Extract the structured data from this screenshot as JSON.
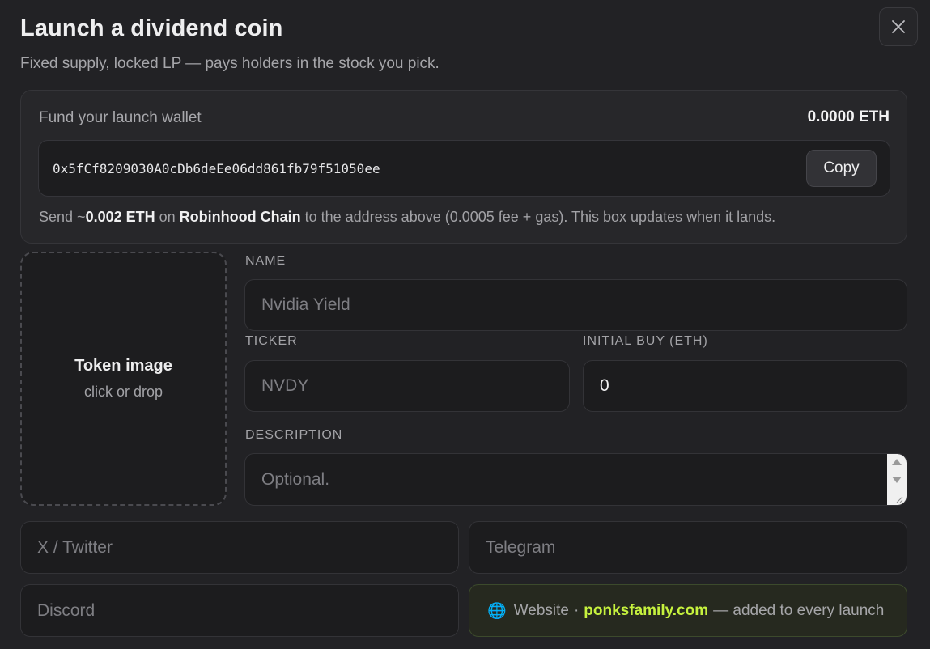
{
  "modal": {
    "title": "Launch a dividend coin",
    "subtitle": "Fixed supply, locked LP — pays holders in the stock you pick.",
    "close_icon": "close-icon"
  },
  "fund": {
    "label": "Fund your launch wallet",
    "balance": "0.0000 ETH",
    "address": "0x5fCf8209030A0cDb6deEe06dd861fb79f51050ee",
    "copy_label": "Copy",
    "note_prefix": "Send ~",
    "note_amount": "0.002 ETH",
    "note_on": " on ",
    "note_chain": "Robinhood Chain",
    "note_suffix": " to the address above (0.0005 fee + gas). This box updates when it lands."
  },
  "image_drop": {
    "title": "Token image",
    "hint": "click or drop"
  },
  "form": {
    "name_label": "NAME",
    "name_placeholder": "Nvidia Yield",
    "ticker_label": "TICKER",
    "ticker_placeholder": "NVDY",
    "initial_buy_label": "INITIAL BUY (ETH)",
    "initial_buy_value": "0",
    "description_label": "DESCRIPTION",
    "description_placeholder": "Optional.",
    "twitter_placeholder": "X / Twitter",
    "telegram_placeholder": "Telegram",
    "discord_placeholder": "Discord"
  },
  "website": {
    "icon": "🌐",
    "label": "Website",
    "separator": "·",
    "domain": "ponksfamily.com",
    "suffix": "— added to every launch"
  },
  "colors": {
    "background": "#222225",
    "accent_green": "#c6f23e"
  }
}
